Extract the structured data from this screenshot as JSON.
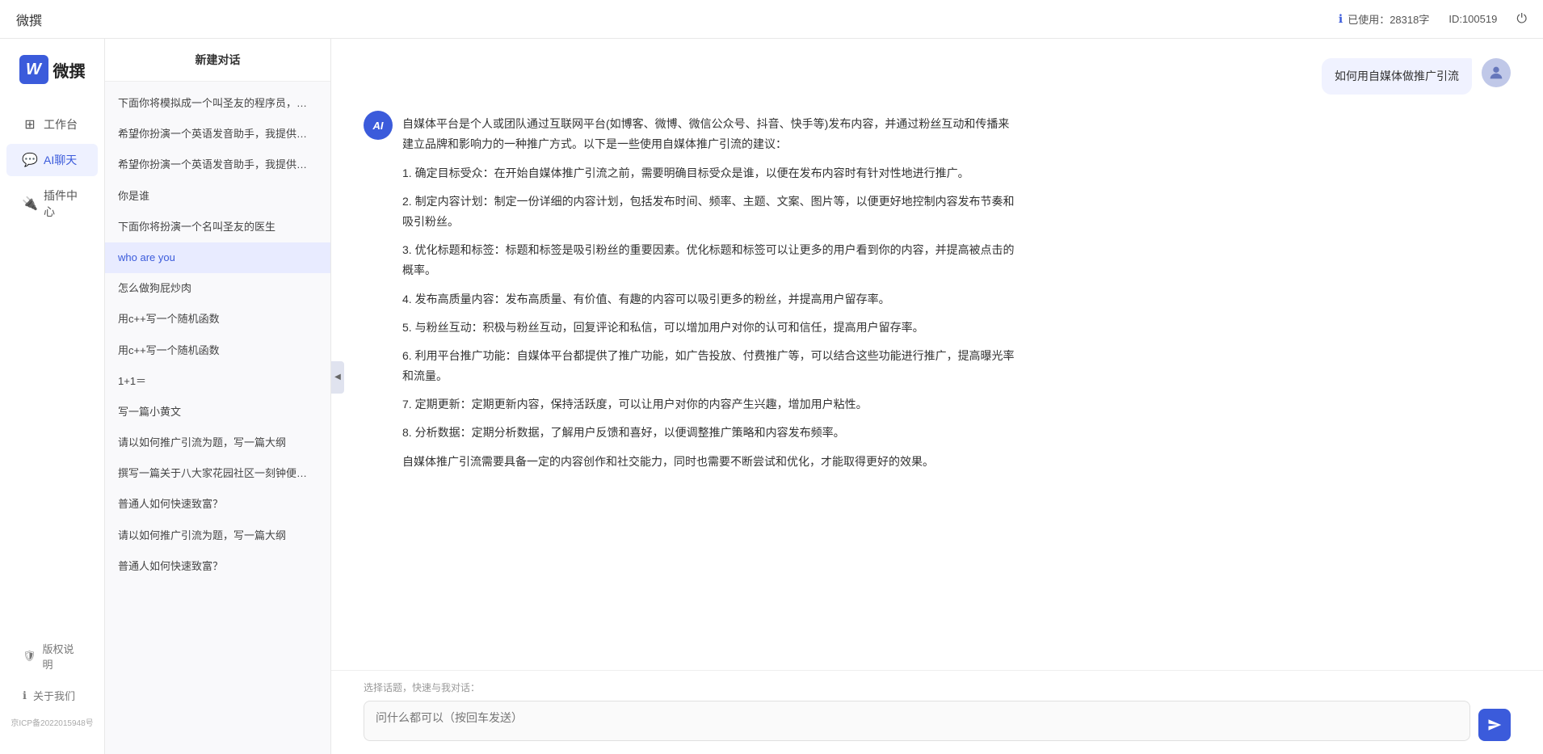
{
  "topbar": {
    "title": "微撰",
    "usage_label": "已使用：28318字",
    "id_label": "ID:100519",
    "usage_icon": "info-icon",
    "logout_icon": "power-icon"
  },
  "logo": {
    "w_letter": "W",
    "app_name": "微撰"
  },
  "nav": {
    "items": [
      {
        "id": "workbench",
        "label": "工作台",
        "icon": "grid-icon"
      },
      {
        "id": "ai-chat",
        "label": "AI聊天",
        "icon": "chat-icon",
        "active": true
      },
      {
        "id": "plugin-center",
        "label": "插件中心",
        "icon": "plugin-icon"
      }
    ],
    "bottom_items": [
      {
        "id": "copyright",
        "label": "版权说明",
        "icon": "shield-icon"
      },
      {
        "id": "about",
        "label": "关于我们",
        "icon": "info-circle-icon"
      }
    ],
    "icp": "京ICP备2022015948号"
  },
  "sidebar": {
    "new_chat": "新建对话",
    "items": [
      {
        "text": "下面你将模拟成一个叫圣友的程序员，我说...",
        "active": false
      },
      {
        "text": "希望你扮演一个英语发音助手，我提供给你...",
        "active": false
      },
      {
        "text": "希望你扮演一个英语发音助手，我提供给你...",
        "active": false
      },
      {
        "text": "你是谁",
        "active": false
      },
      {
        "text": "下面你将扮演一个名叫圣友的医生",
        "active": false
      },
      {
        "text": "who are you",
        "active": true
      },
      {
        "text": "怎么做狗屁炒肉",
        "active": false
      },
      {
        "text": "用c++写一个随机函数",
        "active": false
      },
      {
        "text": "用c++写一个随机函数",
        "active": false
      },
      {
        "text": "1+1＝",
        "active": false
      },
      {
        "text": "写一篇小黄文",
        "active": false
      },
      {
        "text": "请以如何推广引流为题，写一篇大纲",
        "active": false
      },
      {
        "text": "撰写一篇关于八大家花园社区一刻钟便民生...",
        "active": false
      },
      {
        "text": "普通人如何快速致富？",
        "active": false
      },
      {
        "text": "请以如何推广引流为题，写一篇大纲",
        "active": false
      },
      {
        "text": "普通人如何快速致富？",
        "active": false
      }
    ]
  },
  "chat": {
    "messages": [
      {
        "id": "user-1",
        "role": "user",
        "text": "如何用自媒体做推广引流",
        "avatar_type": "user"
      },
      {
        "id": "ai-1",
        "role": "ai",
        "paragraphs": [
          "自媒体平台是个人或团队通过互联网平台(如博客、微博、微信公众号、抖音、快手等)发布内容，并通过粉丝互动和传播来建立品牌和影响力的一种推广方式。以下是一些使用自媒体推广引流的建议：",
          "1. 确定目标受众：在开始自媒体推广引流之前，需要明确目标受众是谁，以便在发布内容时有针对性地进行推广。",
          "2. 制定内容计划：制定一份详细的内容计划，包括发布时间、频率、主题、文案、图片等，以便更好地控制内容发布节奏和吸引粉丝。",
          "3. 优化标题和标签：标题和标签是吸引粉丝的重要因素。优化标题和标签可以让更多的用户看到你的内容，并提高被点击的概率。",
          "4. 发布高质量内容：发布高质量、有价值、有趣的内容可以吸引更多的粉丝，并提高用户留存率。",
          "5. 与粉丝互动：积极与粉丝互动，回复评论和私信，可以增加用户对你的认可和信任，提高用户留存率。",
          "6. 利用平台推广功能：自媒体平台都提供了推广功能，如广告投放、付费推广等，可以结合这些功能进行推广，提高曝光率和流量。",
          "7. 定期更新：定期更新内容，保持活跃度，可以让用户对你的内容产生兴趣，增加用户粘性。",
          "8. 分析数据：定期分析数据，了解用户反馈和喜好，以便调整推广策略和内容发布频率。",
          "自媒体推广引流需要具备一定的内容创作和社交能力，同时也需要不断尝试和优化，才能取得更好的效果。"
        ],
        "avatar_type": "ai"
      }
    ],
    "quick_topic_label": "选择话题，快速与我对话：",
    "input_placeholder": "问什么都可以（按回车发送）",
    "send_icon": "send-icon"
  }
}
